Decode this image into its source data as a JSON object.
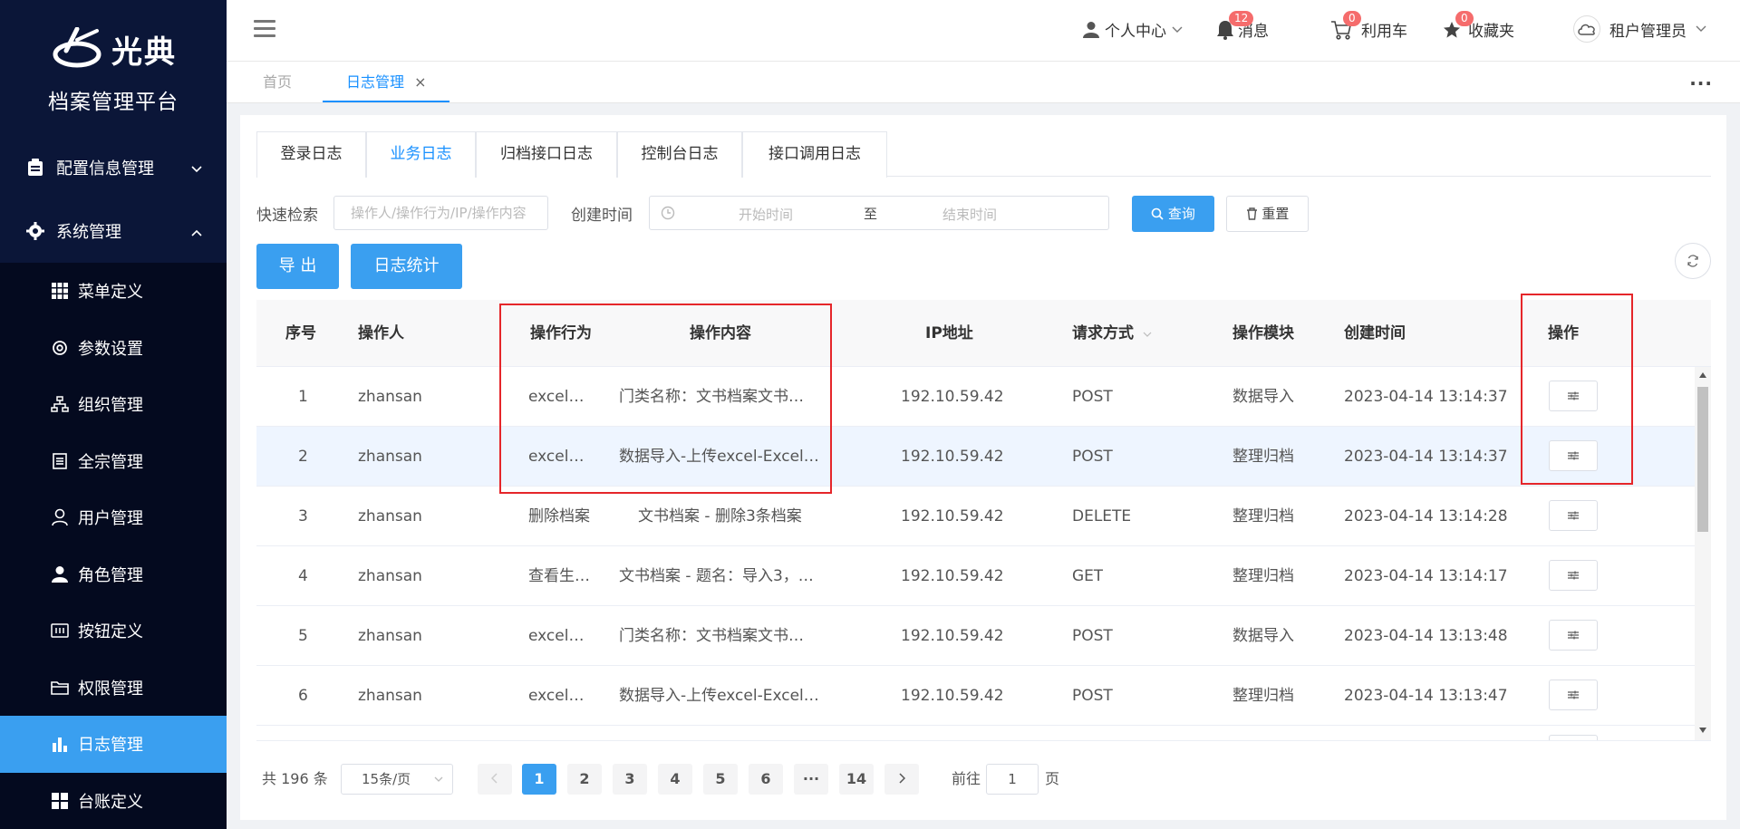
{
  "brand": {
    "logo_text": "光典",
    "platform_title": "档案管理平台"
  },
  "sidebar": {
    "groups": [
      {
        "label": "配置信息管理"
      },
      {
        "label": "系统管理"
      }
    ],
    "items": [
      {
        "label": "菜单定义",
        "icon": "grid-icon"
      },
      {
        "label": "参数设置",
        "icon": "gear-icon"
      },
      {
        "label": "组织管理",
        "icon": "org-icon"
      },
      {
        "label": "全宗管理",
        "icon": "doc-icon"
      },
      {
        "label": "用户管理",
        "icon": "user-icon"
      },
      {
        "label": "角色管理",
        "icon": "role-icon"
      },
      {
        "label": "按钮定义",
        "icon": "button-icon"
      },
      {
        "label": "权限管理",
        "icon": "folder-icon"
      },
      {
        "label": "日志管理",
        "icon": "chart-icon"
      },
      {
        "label": "台账定义",
        "icon": "grid-icon"
      }
    ]
  },
  "header": {
    "user_center": "个人中心",
    "messages": {
      "label": "消息",
      "count": "12"
    },
    "cart": {
      "label": "利用车",
      "count": "0"
    },
    "favorites": {
      "label": "收藏夹",
      "count": "0"
    },
    "admin": "租户管理员"
  },
  "page_tabs": [
    {
      "label": "首页"
    },
    {
      "label": "日志管理",
      "close": "×"
    }
  ],
  "log_tabs": [
    "登录日志",
    "业务日志",
    "归档接口日志",
    "控制台日志",
    "接口调用日志"
  ],
  "filter": {
    "quick_search_label": "快速检索",
    "quick_search_placeholder": "操作人/操作行为/IP/操作内容",
    "created_label": "创建时间",
    "start_placeholder": "开始时间",
    "range_sep": "至",
    "end_placeholder": "结束时间",
    "query_btn": "查询",
    "reset_btn": "重置"
  },
  "actions": {
    "export": "导 出",
    "stats": "日志统计"
  },
  "table": {
    "headers": {
      "index": "序号",
      "operator": "操作人",
      "action": "操作行为",
      "content": "操作内容",
      "ip": "IP地址",
      "method": "请求方式",
      "module": "操作模块",
      "created": "创建时间",
      "ops": "操作"
    },
    "rows": [
      {
        "index": "1",
        "operator": "zhansan",
        "action": "excel…",
        "content": "门类名称：文书档案文书…",
        "ip": "192.10.59.42",
        "method": "POST",
        "module": "数据导入",
        "created": "2023-04-14 13:14:37"
      },
      {
        "index": "2",
        "operator": "zhansan",
        "action": "excel…",
        "content": "数据导入-上传excel-Excel…",
        "ip": "192.10.59.42",
        "method": "POST",
        "module": "整理归档",
        "created": "2023-04-14 13:14:37"
      },
      {
        "index": "3",
        "operator": "zhansan",
        "action": "删除档案",
        "content": "文书档案 - 删除3条档案",
        "ip": "192.10.59.42",
        "method": "DELETE",
        "module": "整理归档",
        "created": "2023-04-14 13:14:28"
      },
      {
        "index": "4",
        "operator": "zhansan",
        "action": "查看生…",
        "content": "文书档案 - 题名：导入3，…",
        "ip": "192.10.59.42",
        "method": "GET",
        "module": "整理归档",
        "created": "2023-04-14 13:14:17"
      },
      {
        "index": "5",
        "operator": "zhansan",
        "action": "excel…",
        "content": "门类名称：文书档案文书…",
        "ip": "192.10.59.42",
        "method": "POST",
        "module": "数据导入",
        "created": "2023-04-14 13:13:48"
      },
      {
        "index": "6",
        "operator": "zhansan",
        "action": "excel…",
        "content": "数据导入-上传excel-Excel…",
        "ip": "192.10.59.42",
        "method": "POST",
        "module": "整理归档",
        "created": "2023-04-14 13:13:47"
      }
    ]
  },
  "pagination": {
    "total": "共 196 条",
    "page_size": "15条/页",
    "pages": [
      "1",
      "2",
      "3",
      "4",
      "5",
      "6",
      "···",
      "14"
    ],
    "goto_label": "前往",
    "goto_value": "1",
    "page_unit": "页"
  },
  "colors": {
    "sidebar_bg": "#0b1638",
    "accent": "#3a9ff0",
    "highlight_box": "#e5262a",
    "badge": "#f56c6c"
  }
}
